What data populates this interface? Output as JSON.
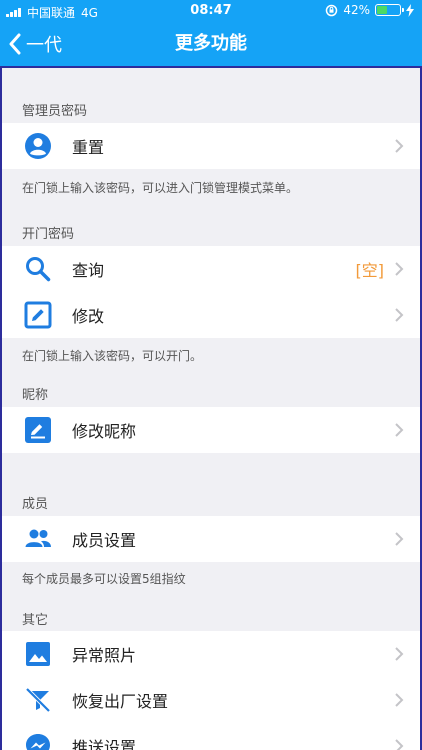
{
  "status_bar": {
    "carrier": "中国联通",
    "network": "4G",
    "time": "08:47",
    "battery_percent": "42%",
    "battery_level": 0.42
  },
  "nav": {
    "back_label": "一代",
    "title": "更多功能"
  },
  "sections": {
    "admin": {
      "header": "管理员密码",
      "reset_label": "重置",
      "note": "在门锁上输入该密码，可以进入门锁管理模式菜单。"
    },
    "door": {
      "header": "开门密码",
      "query_label": "查询",
      "query_value": "[空]",
      "modify_label": "修改",
      "note": "在门锁上输入该密码，可以开门。"
    },
    "nickname": {
      "header": "昵称",
      "modify_label": "修改昵称"
    },
    "members": {
      "header": "成员",
      "settings_label": "成员设置",
      "note": "每个成员最多可以设置5组指纹"
    },
    "other": {
      "header": "其它",
      "photos_label": "异常照片",
      "factory_reset_label": "恢复出厂设置",
      "push_label": "推送设置"
    }
  },
  "colors": {
    "nav_bg": "#15a3f6",
    "icon_blue": "#1f7de0",
    "value_orange": "#f29a3a",
    "list_bg": "#f0f0f4"
  }
}
